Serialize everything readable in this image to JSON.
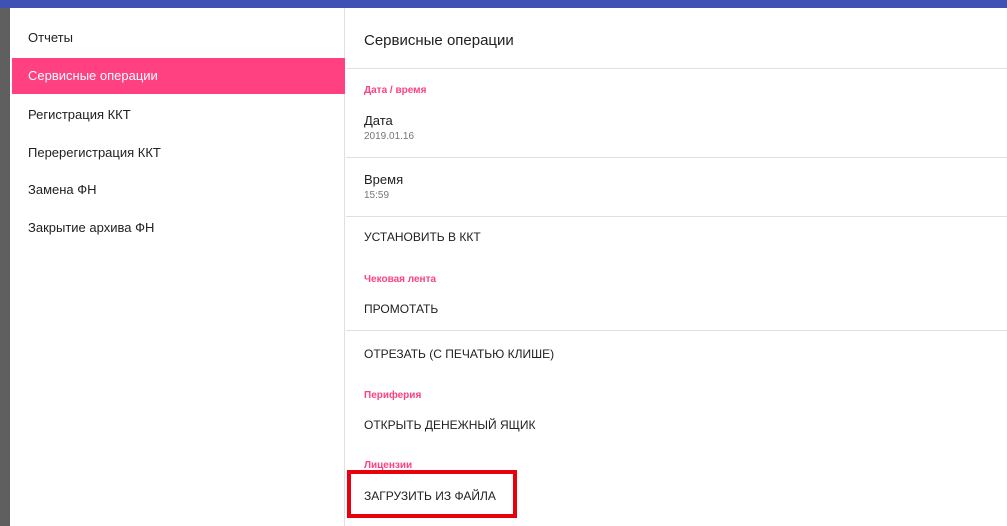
{
  "sidebar": {
    "items": [
      {
        "label": "Отчеты"
      },
      {
        "label": "Сервисные операции"
      },
      {
        "label": "Регистрация ККТ"
      },
      {
        "label": "Перерегистрация ККТ"
      },
      {
        "label": "Замена ФН"
      },
      {
        "label": "Закрытие архива ФН"
      }
    ],
    "active_index": 1
  },
  "content": {
    "title": "Сервисные операции",
    "datetime_category": "Дата / время",
    "date": {
      "title": "Дата",
      "value": "2019.01.16"
    },
    "time": {
      "title": "Время",
      "value": "15:59"
    },
    "set_in_kkt": "УСТАНОВИТЬ В ККТ",
    "receipt_tape_category": "Чековая лента",
    "scroll_tape": "ПРОМОТАТЬ",
    "cut_tape": "ОТРЕЗАТЬ (С ПЕЧАТЬЮ КЛИШЕ)",
    "peripherals_category": "Периферия",
    "open_cash_drawer": "ОТКРЫТЬ ДЕНЕЖНЫЙ ЯЩИК",
    "licenses_category": "Лицензии",
    "load_from_file": "ЗАГРУЗИТЬ ИЗ ФАЙЛА"
  },
  "colors": {
    "accent": "#ff4081",
    "app_bar": "#3f51b5",
    "highlight": "#e8000d"
  }
}
